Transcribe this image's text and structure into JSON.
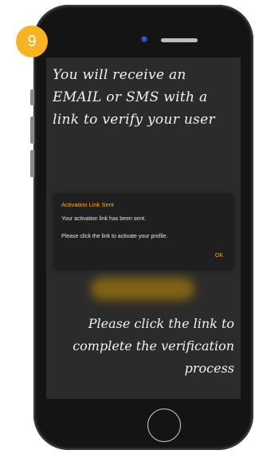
{
  "step_badge": "9",
  "headline": [
    "You will receive an",
    "EMAIL or SMS with a",
    "link to verify your user"
  ],
  "dialog": {
    "title": "Activation Link Sent",
    "line1": "Your activation link has been sent.",
    "line2": "Please click the link to activate your profile.",
    "ok_label": "OK"
  },
  "footer": [
    "Please click the link to",
    "complete the verification",
    "process"
  ],
  "colors": {
    "badge": "#f6b422",
    "accent": "#f5b014",
    "screen_bg": "#2b2b2b",
    "phone_body": "#141414"
  },
  "icons": {
    "home": "home-button-icon",
    "camera": "front-camera-icon",
    "speaker": "speaker-grille-icon"
  }
}
